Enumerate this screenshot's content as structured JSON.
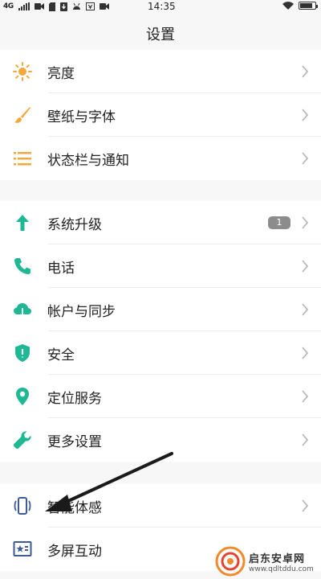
{
  "status_bar": {
    "network": "4G",
    "time": "14:35",
    "battery_level": 0.85
  },
  "header": {
    "title": "设置"
  },
  "groups": [
    {
      "items": [
        {
          "label": "亮度",
          "icon": "sun-icon"
        },
        {
          "label": "壁纸与字体",
          "icon": "brush-icon"
        },
        {
          "label": "状态栏与通知",
          "icon": "list-icon"
        }
      ]
    },
    {
      "items": [
        {
          "label": "系统升级",
          "icon": "arrow-up-icon",
          "badge": "1"
        },
        {
          "label": "电话",
          "icon": "phone-icon"
        },
        {
          "label": "帐户与同步",
          "icon": "cloud-icon"
        },
        {
          "label": "安全",
          "icon": "shield-icon"
        },
        {
          "label": "定位服务",
          "icon": "location-pin-icon"
        },
        {
          "label": "更多设置",
          "icon": "wrench-icon"
        }
      ]
    },
    {
      "items": [
        {
          "label": "智能体感",
          "icon": "phone-motion-icon"
        },
        {
          "label": "多屏互动",
          "icon": "screen-star-icon"
        }
      ]
    }
  ],
  "colors": {
    "accent_green": "#1fb894",
    "icon_orange": "#f2a93b",
    "icon_blue": "#3d5a9a"
  },
  "watermark": {
    "name": "启东安卓网",
    "url": "www.qdltddu.com"
  }
}
